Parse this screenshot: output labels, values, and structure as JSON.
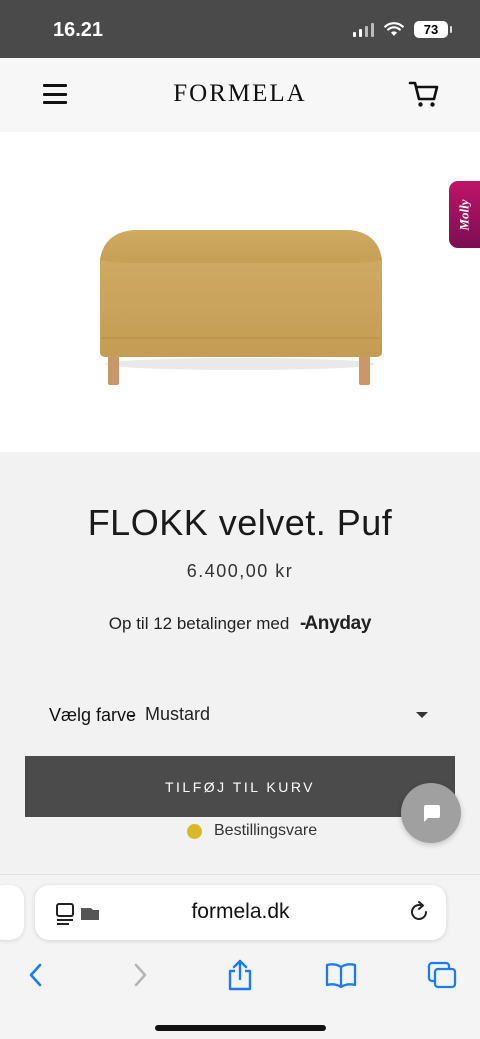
{
  "status_bar": {
    "time": "16.21",
    "battery": "73"
  },
  "header": {
    "logo": "FORMELA"
  },
  "molly_tab": {
    "label": "Molly"
  },
  "product": {
    "title": "FLOKK velvet. Puf",
    "price": "6.400,00 kr",
    "installments_text": "Op til 12 betalinger med",
    "installments_brand": "Anyday",
    "color_label": "Vælg farve",
    "color_separator": "-",
    "color_value": "Mustard",
    "add_to_cart": "TILFØJ TIL KURV",
    "stock_status": "Bestillingsvare",
    "stock_color": "#d8b92a",
    "upholstery_color": "#c9a45c"
  },
  "browser": {
    "url": "formela.dk"
  }
}
